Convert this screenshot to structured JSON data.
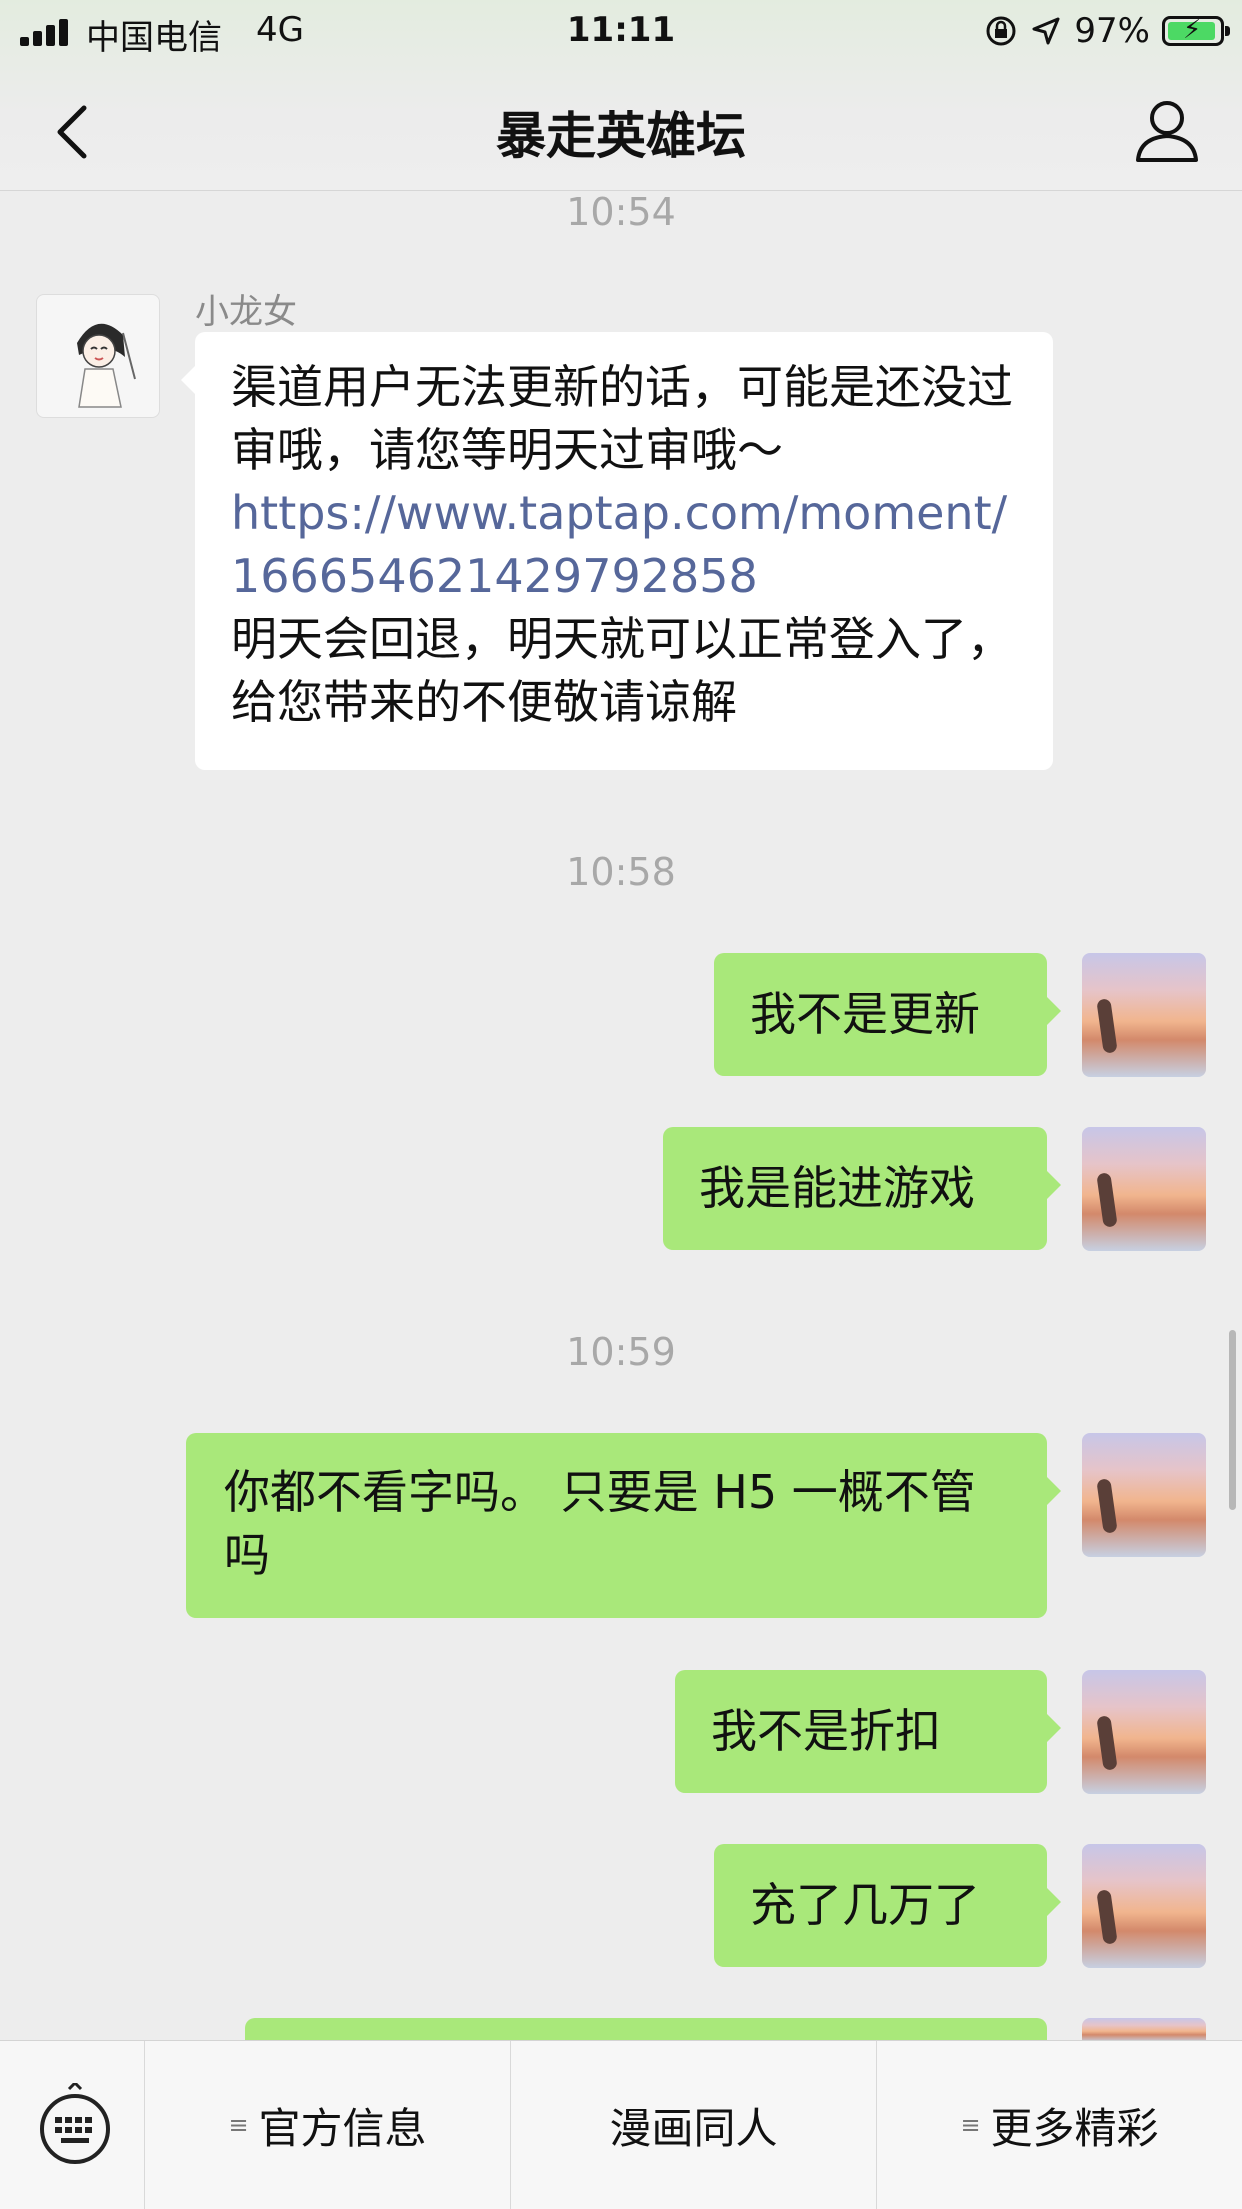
{
  "status": {
    "carrier": "中国电信",
    "network": "4G",
    "time": "11:11",
    "battery": "97%"
  },
  "nav": {
    "title": "暴走英雄坛"
  },
  "chat": {
    "time1": "10:54",
    "incoming": {
      "sender": "小龙女",
      "line1": "渠道用户无法更新的话，可能是还没过审哦，请您等明天过审哦～",
      "link": "https://www.taptap.com/moment/16665462142979285",
      "link_tail": "8",
      "line2": "明天会回退，明天就可以正常登入了，给您带来的不便敬请谅解"
    },
    "time2": "10:58",
    "msg1": "我不是更新",
    "msg2": "我是能进游戏",
    "time3": "10:59",
    "msg3": " 你都不看字吗。 只要是 H5 一概不管吗",
    "msg4": "我不是折扣",
    "msg5": "充了几万了"
  },
  "menu": {
    "item1": "官方信息",
    "item2": "漫画同人",
    "item3": "更多精彩"
  }
}
